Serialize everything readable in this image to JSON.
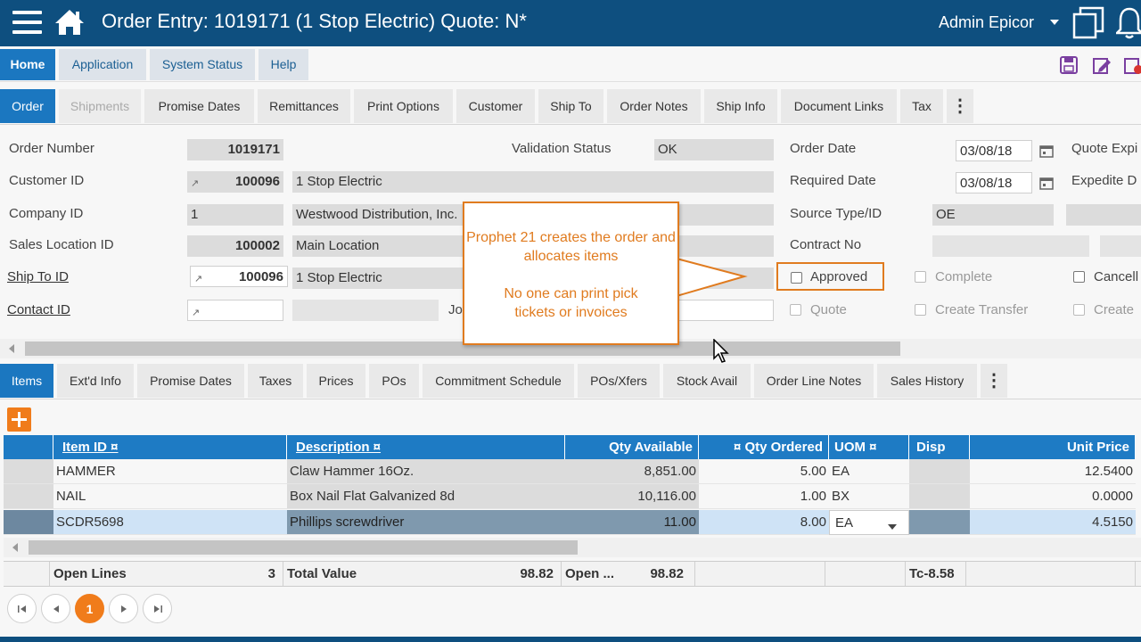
{
  "titlebar": {
    "title": "Order Entry: 1019171 (1 Stop Electric) Quote: N*",
    "user": "Admin Epicor"
  },
  "menu": {
    "tabs": [
      "Home",
      "Application",
      "System Status",
      "Help"
    ]
  },
  "order_tabs": [
    "Order",
    "Shipments",
    "Promise Dates",
    "Remittances",
    "Print Options",
    "Customer",
    "Ship To",
    "Order Notes",
    "Ship Info",
    "Document Links",
    "Tax"
  ],
  "form": {
    "order_number_label": "Order Number",
    "order_number": "1019171",
    "validation_status_label": "Validation Status",
    "validation_status": "OK",
    "order_date_label": "Order Date",
    "order_date": "03/08/18",
    "quote_expire_label": "Quote Expi",
    "customer_id_label": "Customer ID",
    "customer_id": "100096",
    "customer_name": "1 Stop Electric",
    "required_date_label": "Required Date",
    "required_date": "03/08/18",
    "expedite_label": "Expedite D",
    "company_id_label": "Company ID",
    "company_id": "1",
    "company_name": "Westwood Distribution, Inc.",
    "source_type_label": "Source Type/ID",
    "source_type": "OE",
    "sales_location_label": "Sales Location ID",
    "sales_location_id": "100002",
    "sales_location_name": "Main Location",
    "contract_no_label": "Contract No",
    "ship_to_label": "Ship To ID",
    "ship_to_id": "100096",
    "ship_to_name": "1 Stop Electric",
    "approved_label": "Approved",
    "complete_label": "Complete",
    "cancelled_label": "Cancell",
    "contact_id_label": "Contact ID",
    "job_label": "Jo",
    "quote_label": "Quote",
    "create_transfer_label": "Create Transfer",
    "create_label": "Create"
  },
  "callout": {
    "line1": "Prophet 21 creates the order and allocates items",
    "line2": "No one can print pick tickets or invoices"
  },
  "item_tabs": [
    "Items",
    "Ext'd Info",
    "Promise Dates",
    "Taxes",
    "Prices",
    "POs",
    "Commitment Schedule",
    "POs/Xfers",
    "Stock Avail",
    "Order Line Notes",
    "Sales History"
  ],
  "grid": {
    "headers": {
      "item_id": "Item ID ¤",
      "description": "Description ¤",
      "qty_available": "Qty Available",
      "qty_ordered": "¤ Qty Ordered",
      "uom": "UOM ¤",
      "disp": "Disp",
      "unit_price": "Unit Price"
    },
    "rows": [
      {
        "item_id": "HAMMER",
        "description": "Claw Hammer 16Oz.",
        "qty_available": "8,851.00",
        "qty_ordered": "5.00",
        "uom": "EA",
        "unit_price": "12.5400"
      },
      {
        "item_id": "NAIL",
        "description": "Box Nail Flat Galvanized 8d",
        "qty_available": "10,116.00",
        "qty_ordered": "1.00",
        "uom": "BX",
        "unit_price": "0.0000"
      },
      {
        "item_id": "SCDR5698",
        "description": "Phillips screwdriver",
        "qty_available": "11.00",
        "qty_ordered": "8.00",
        "uom": "EA",
        "unit_price": "4.5150"
      }
    ]
  },
  "totals": {
    "open_lines_label": "Open Lines",
    "open_lines": "3",
    "total_value_label": "Total Value",
    "total_value": "98.82",
    "open_label": "Open ...",
    "open_value": "98.82",
    "tc_value": "Tc-8.58"
  },
  "pager": {
    "current": "1"
  },
  "colors": {
    "titlebar": "#0e4f7f",
    "accent": "#1b77c0",
    "callout": "#e07b1f"
  }
}
